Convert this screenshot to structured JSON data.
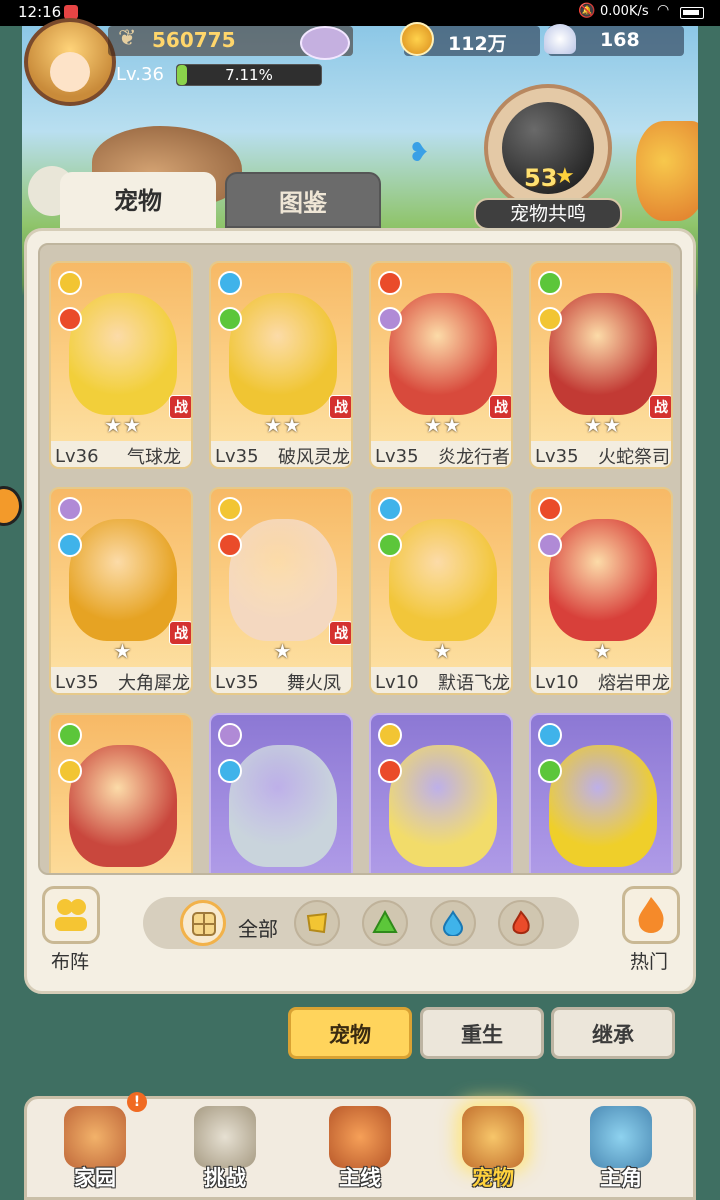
{
  "status_bar": {
    "time": "12:16",
    "net_speed": "0.00K/s"
  },
  "player": {
    "power": "560775",
    "level": "Lv.36",
    "exp_percent": "7.11%",
    "exp_fraction": 0.0711
  },
  "currency": {
    "coins": "112万",
    "shells": "168"
  },
  "resonance": {
    "count": "53",
    "label": "宠物共鸣"
  },
  "tabs": [
    {
      "label": "宠物",
      "active": true
    },
    {
      "label": "图鉴",
      "active": false
    }
  ],
  "pets": [
    {
      "level": "Lv36",
      "name": "气球龙",
      "stars": "★★",
      "in_battle": true,
      "bg": "orange",
      "color": "#f2cf3a"
    },
    {
      "level": "Lv35",
      "name": "破风灵龙",
      "stars": "★★",
      "in_battle": true,
      "bg": "orange",
      "color": "#f0c533"
    },
    {
      "level": "Lv35",
      "name": "炎龙行者",
      "stars": "★★",
      "in_battle": true,
      "bg": "orange",
      "color": "#d84a3c"
    },
    {
      "level": "Lv35",
      "name": "火蛇祭司",
      "stars": "★★",
      "in_battle": true,
      "bg": "orange",
      "color": "#c23a34"
    },
    {
      "level": "Lv35",
      "name": "大角犀龙",
      "stars": "★",
      "in_battle": true,
      "bg": "orange",
      "color": "#e6a323"
    },
    {
      "level": "Lv35",
      "name": "舞火凤",
      "stars": "★",
      "in_battle": true,
      "bg": "orange",
      "color": "#f4d8c0"
    },
    {
      "level": "Lv10",
      "name": "默语飞龙",
      "stars": "★",
      "in_battle": false,
      "bg": "orange",
      "color": "#f2c63a"
    },
    {
      "level": "Lv10",
      "name": "熔岩甲龙",
      "stars": "★",
      "in_battle": false,
      "bg": "orange",
      "color": "#d8403a"
    },
    {
      "level": "",
      "name": "",
      "stars": "",
      "in_battle": false,
      "bg": "orange",
      "color": "#c9473d"
    },
    {
      "level": "",
      "name": "",
      "stars": "",
      "in_battle": false,
      "bg": "purple",
      "color": "#c9d4dc"
    },
    {
      "level": "",
      "name": "",
      "stars": "",
      "in_battle": false,
      "bg": "purple",
      "color": "#f2dc6a"
    },
    {
      "level": "",
      "name": "",
      "stars": "",
      "in_battle": false,
      "bg": "purple",
      "color": "#efcf2a"
    }
  ],
  "battle_badge": "战",
  "toolbar": {
    "formation_label": "布阵",
    "hot_label": "热门",
    "all_label": "全部",
    "filters": [
      "all",
      "earth",
      "grass",
      "water",
      "fire"
    ]
  },
  "sub_tabs": [
    {
      "label": "宠物",
      "active": true
    },
    {
      "label": "重生",
      "active": false
    },
    {
      "label": "继承",
      "active": false
    }
  ],
  "nav": [
    {
      "label": "家园",
      "icon": "home-icon",
      "active": false,
      "alert": "!"
    },
    {
      "label": "挑战",
      "icon": "challenge-icon",
      "active": false
    },
    {
      "label": "主线",
      "icon": "main-quest-icon",
      "active": false
    },
    {
      "label": "宠物",
      "icon": "pet-icon",
      "active": true
    },
    {
      "label": "主角",
      "icon": "hero-icon",
      "active": false
    }
  ],
  "colors": {
    "accent": "#ffd45c",
    "battle_red": "#d4312f",
    "exp_green": "#8bd34b"
  }
}
